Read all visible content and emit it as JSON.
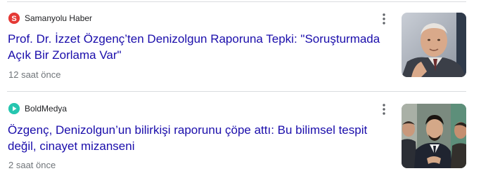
{
  "articles": [
    {
      "source": "Samanyolu Haber",
      "favicon_icon": "samanyolu-s-logo-icon",
      "favicon_color": "#e53935",
      "headline": "Prof. Dr. İzzet Özgenç’ten Denizolgun Raporuna Tepki: \"Soruşturmada Açık Bir Zorlama Var\"",
      "time": "12 saat önce",
      "thumbnail": "portrait-elderly-man-photo"
    },
    {
      "source": "BoldMedya",
      "favicon_icon": "boldmedya-play-logo-icon",
      "favicon_color": "#26c6b0",
      "headline": "Özgenç, Denizolgun’un bilirkişi raporunu çöpe attı: Bu bilimsel tespit değil, cinayet mizanseni",
      "time": "2 saat önce",
      "thumbnail": "group-of-men-photo"
    }
  ],
  "colors": {
    "headline": "#1a0dab",
    "meta": "#70757a",
    "divider": "#dadce0"
  }
}
